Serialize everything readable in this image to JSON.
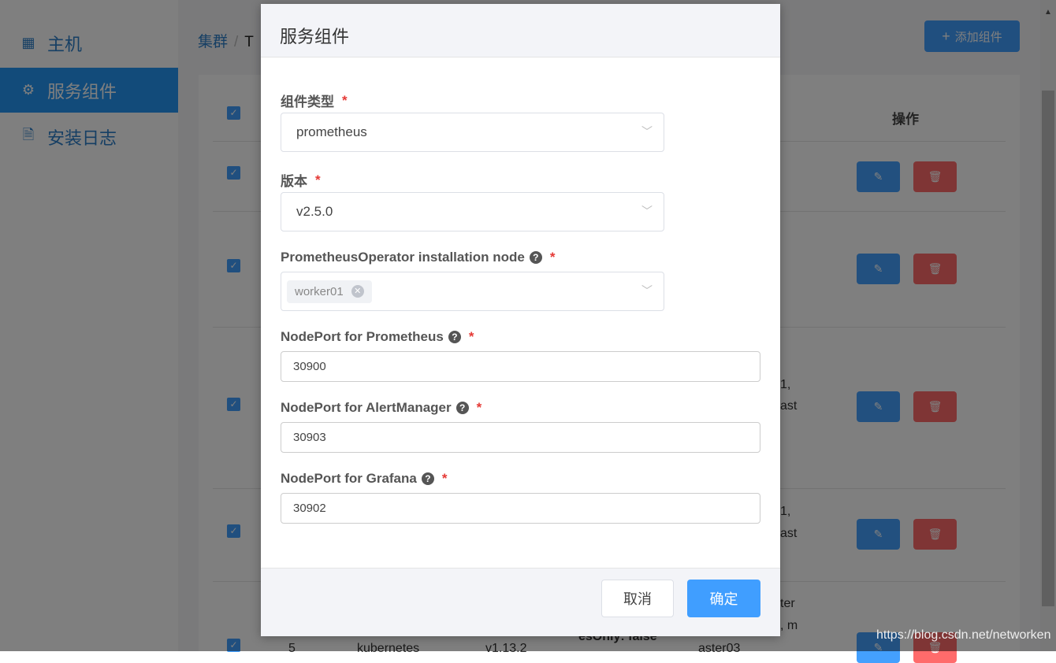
{
  "sidebar": {
    "items": [
      {
        "label": "主机",
        "icon": "grid-icon"
      },
      {
        "label": "服务组件",
        "icon": "gear-icon",
        "active": true
      },
      {
        "label": "安装日志",
        "icon": "document-icon"
      }
    ]
  },
  "breadcrumb": {
    "root": "集群",
    "separator": "/",
    "current": "T"
  },
  "toolbar": {
    "add_label": "添加组件",
    "add_icon": "+"
  },
  "table": {
    "operations_header": "操作",
    "row_fragments": [
      "1,",
      "ast",
      "1,",
      "ast",
      "ter",
      ", m",
      "5",
      "kubernetes",
      "v1.13.2",
      "esOnly: false",
      "aster03"
    ]
  },
  "dialog": {
    "title": "服务组件",
    "fields": [
      {
        "label": "组件类型",
        "required": true,
        "type": "select",
        "value": "prometheus"
      },
      {
        "label": "版本",
        "required": true,
        "type": "select",
        "value": "v2.5.0"
      },
      {
        "label": "PrometheusOperator installation node",
        "help": true,
        "required": true,
        "type": "multiselect",
        "tags": [
          "worker01"
        ]
      },
      {
        "label": "NodePort for Prometheus",
        "help": true,
        "required": true,
        "type": "input",
        "value": "30900"
      },
      {
        "label": "NodePort for AlertManager",
        "help": true,
        "required": true,
        "type": "input",
        "value": "30903"
      },
      {
        "label": "NodePort for Grafana",
        "help": true,
        "required": true,
        "type": "input",
        "value": "30902"
      }
    ],
    "cancel_label": "取消",
    "ok_label": "确定"
  },
  "watermark": "https://blog.csdn.net/networken",
  "colors": {
    "primary": "#409eff",
    "danger": "#f56c6c",
    "required": "#e53935"
  }
}
